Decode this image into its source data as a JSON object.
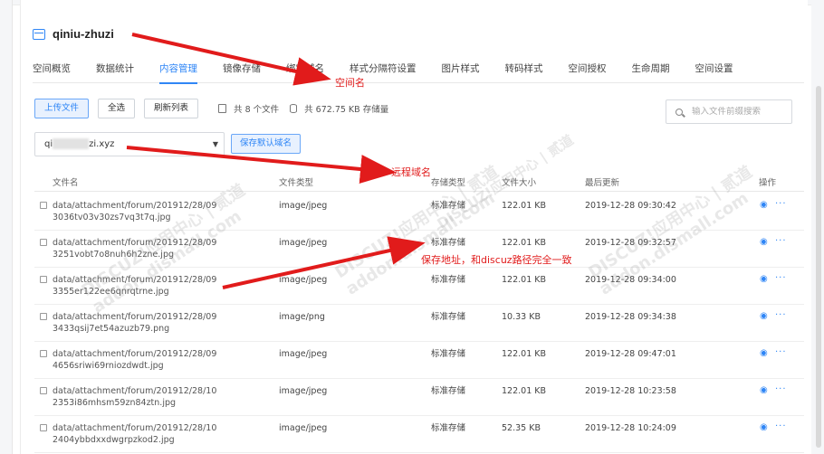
{
  "bucket": {
    "name": "qiniu-zhuzi"
  },
  "tabs": [
    {
      "label": "空间概览"
    },
    {
      "label": "数据统计"
    },
    {
      "label": "内容管理",
      "active": true
    },
    {
      "label": "镜像存储"
    },
    {
      "label": "绑定域名"
    },
    {
      "label": "样式分隔符设置"
    },
    {
      "label": "图片样式"
    },
    {
      "label": "转码样式"
    },
    {
      "label": "空间授权"
    },
    {
      "label": "生命周期"
    },
    {
      "label": "空间设置"
    }
  ],
  "toolbar": {
    "upload_label": "上传文件",
    "select_all_label": "全选",
    "refresh_label": "刷新列表",
    "file_count": "共 8 个文件",
    "storage_used": "共 672.75 KB 存储量"
  },
  "search": {
    "placeholder": "输入文件前缀搜索"
  },
  "domain": {
    "value_prefix": "qi",
    "value_suffix": "zi.xyz",
    "save_default_label": "保存默认域名"
  },
  "table": {
    "headers": {
      "name": "文件名",
      "type": "文件类型",
      "storage": "存储类型",
      "size": "文件大小",
      "updated": "最后更新",
      "actions": "操作"
    },
    "rows": [
      {
        "name_line1": "data/attachment/forum/201912/28/09",
        "name_line2": "3036tv03v30zs7vq3t7q.jpg",
        "type": "image/jpeg",
        "storage": "标准存储",
        "size": "122.01 KB",
        "updated": "2019-12-28 09:30:42"
      },
      {
        "name_line1": "data/attachment/forum/201912/28/09",
        "name_line2": "3251vobt7o8nuh6h2zne.jpg",
        "type": "image/jpeg",
        "storage": "标准存储",
        "size": "122.01 KB",
        "updated": "2019-12-28 09:32:57"
      },
      {
        "name_line1": "data/attachment/forum/201912/28/09",
        "name_line2": "3355er122ee6qnrqtrne.jpg",
        "type": "image/jpeg",
        "storage": "标准存储",
        "size": "122.01 KB",
        "updated": "2019-12-28 09:34:00"
      },
      {
        "name_line1": "data/attachment/forum/201912/28/09",
        "name_line2": "3433qsij7et54azuzb79.png",
        "type": "image/png",
        "storage": "标准存储",
        "size": "10.33 KB",
        "updated": "2019-12-28 09:34:38"
      },
      {
        "name_line1": "data/attachment/forum/201912/28/09",
        "name_line2": "4656sriwi69rniozdwdt.jpg",
        "type": "image/jpeg",
        "storage": "标准存储",
        "size": "122.01 KB",
        "updated": "2019-12-28 09:47:01"
      },
      {
        "name_line1": "data/attachment/forum/201912/28/10",
        "name_line2": "2353i86mhsm59zn84ztn.jpg",
        "type": "image/jpeg",
        "storage": "标准存储",
        "size": "122.01 KB",
        "updated": "2019-12-28 10:23:58"
      },
      {
        "name_line1": "data/attachment/forum/201912/28/10",
        "name_line2": "2404ybbdxxdwgrpzkod2.jpg",
        "type": "image/jpeg",
        "storage": "标准存储",
        "size": "52.35 KB",
        "updated": "2019-12-28 10:24:09"
      }
    ]
  },
  "annotations": {
    "bucket_name": "空间名",
    "remote_domain": "远程域名",
    "save_path": "保存地址，和discuz路径完全一致",
    "color": "#e11b1b"
  },
  "watermark": {
    "line1": "DISCUZ!应用中心 | 贰道",
    "line2": "addon.dismall.com"
  },
  "colors": {
    "accent": "#2f86f6",
    "annotation": "#e11b1b"
  }
}
